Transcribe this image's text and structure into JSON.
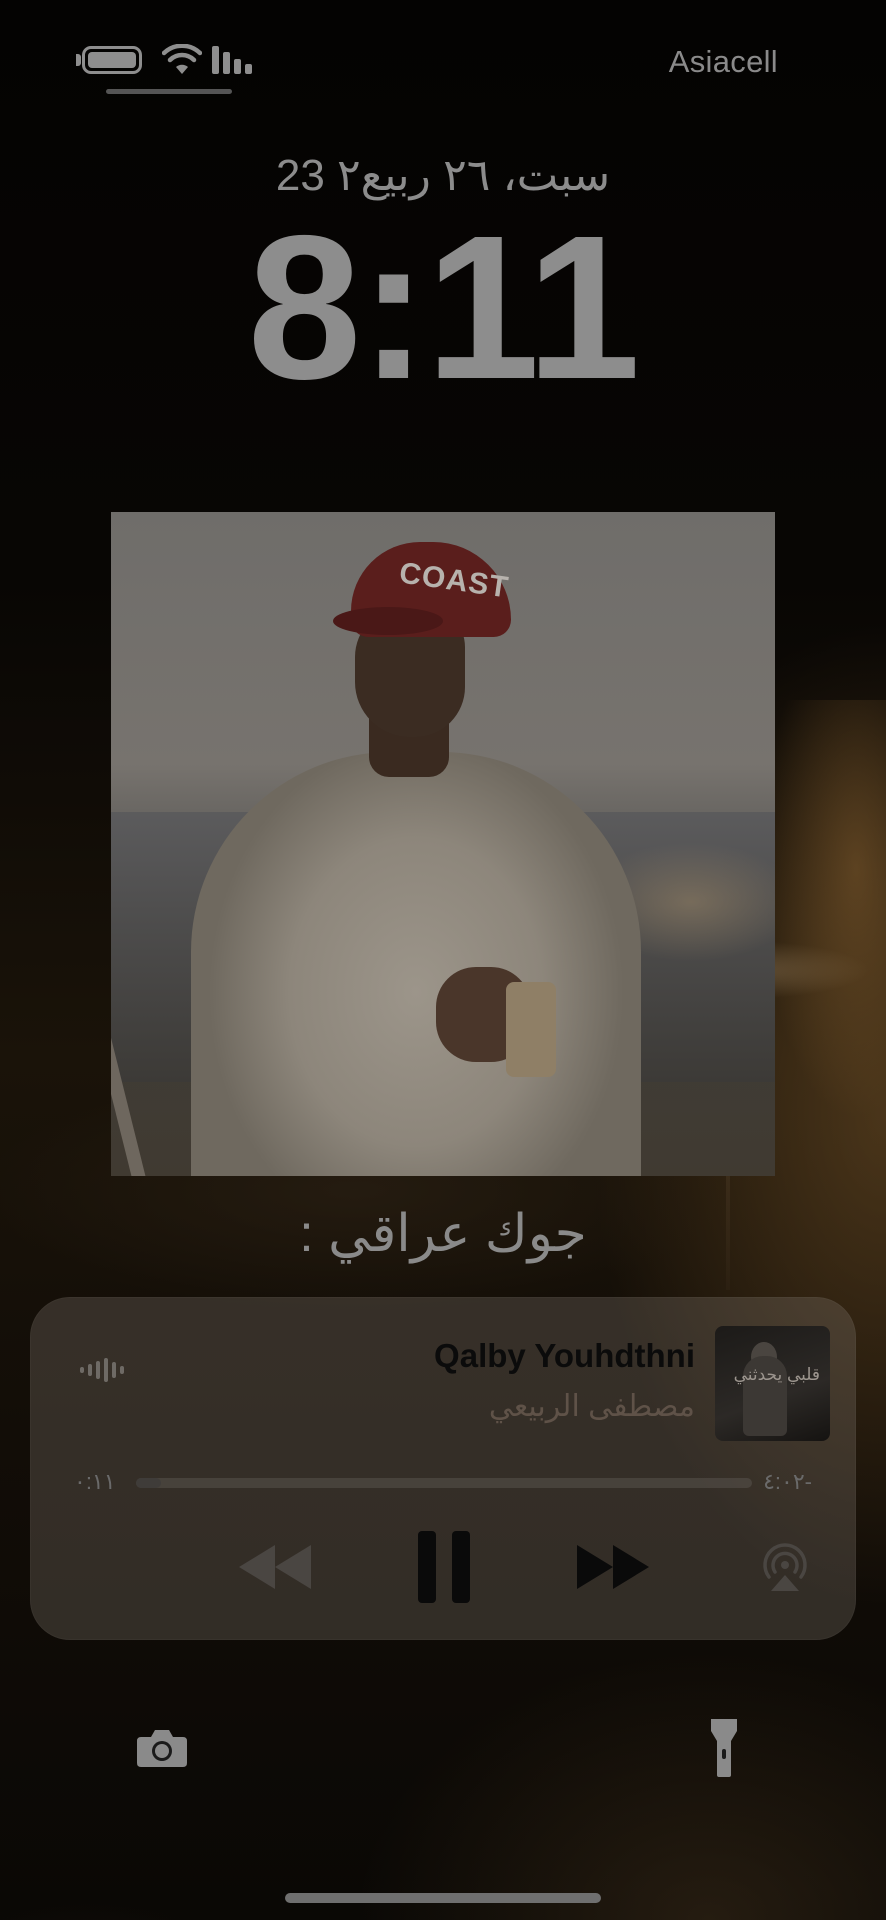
{
  "status_bar": {
    "carrier": "Asiacell",
    "icons": [
      "battery-icon",
      "wifi-icon",
      "signal-icon"
    ]
  },
  "lock_screen": {
    "date": "سبت، ٢٦ ربيع٢ 23",
    "time": "8:11"
  },
  "photo_widget": {
    "cap_text": "COAST",
    "caption": "جوك عراقي :"
  },
  "now_playing": {
    "title": "Qalby Youhdthni",
    "artist": "مصطفى الربيعي",
    "elapsed": "٠:١١",
    "remaining": "-٤:٠٢",
    "progress": 0.04,
    "art_text": "قلبي يحدثني",
    "controls": [
      "rewind-icon",
      "pause-icon",
      "fast-forward-icon",
      "airplay-icon"
    ]
  },
  "bottom": {
    "left": "camera-icon",
    "right": "flashlight-icon"
  },
  "colors": {
    "text_dim": "#8a8a8a",
    "card_bg": "#787066",
    "title_dark": "#0b0b0b"
  }
}
